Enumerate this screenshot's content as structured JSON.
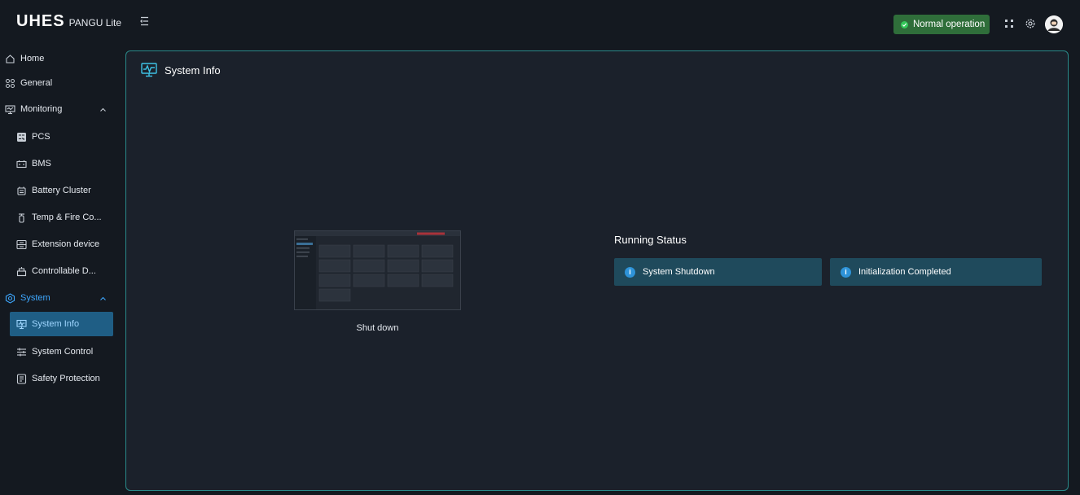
{
  "app": {
    "brand": "UHES",
    "product": "PANGU Lite"
  },
  "header": {
    "status_label": "Normal operation",
    "status_color": "#2f6e3a",
    "icons": [
      "fullscreen-icon",
      "settings-icon",
      "user-avatar"
    ]
  },
  "sidebar": {
    "items": [
      {
        "label": "Home",
        "icon": "home-icon"
      },
      {
        "label": "General",
        "icon": "grid-icon"
      },
      {
        "label": "Monitoring",
        "icon": "monitor-icon"
      },
      {
        "label": "PCS",
        "icon": "pcs-icon"
      },
      {
        "label": "BMS",
        "icon": "battery-icon"
      },
      {
        "label": "Battery Cluster",
        "icon": "battery-cluster-icon"
      },
      {
        "label": "Temp & Fire Co...",
        "icon": "fire-extinguisher-icon"
      },
      {
        "label": "Extension device",
        "icon": "extension-device-icon"
      },
      {
        "label": "Controllable D...",
        "icon": "controllable-device-icon"
      },
      {
        "label": "System",
        "icon": "system-icon"
      },
      {
        "label": "System Info",
        "icon": "system-info-icon"
      },
      {
        "label": "System Control",
        "icon": "sliders-icon"
      },
      {
        "label": "Safety Protection",
        "icon": "safety-icon"
      }
    ],
    "active_item": "System Info",
    "accent_color": "#3ea8ff"
  },
  "main": {
    "title": "System Info",
    "device_state_caption": "Shut down",
    "running_status": {
      "title": "Running Status",
      "items": [
        "System Shutdown",
        "Initialization Completed"
      ]
    }
  }
}
